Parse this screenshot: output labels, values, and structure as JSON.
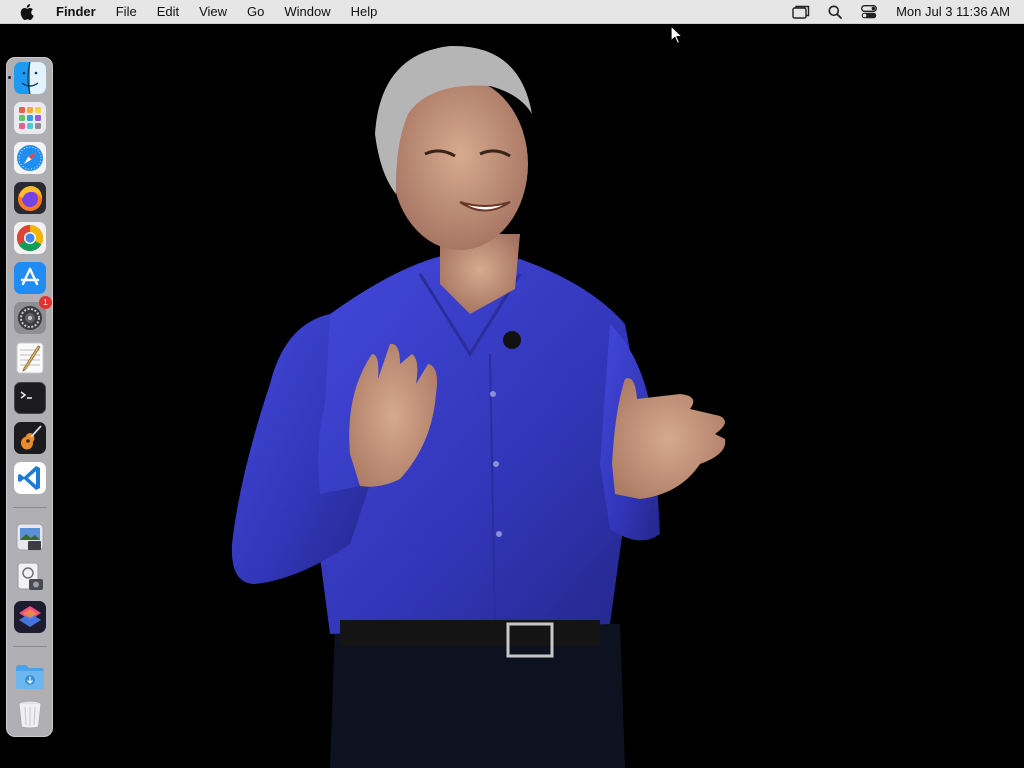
{
  "menubar": {
    "app_name": "Finder",
    "menus": [
      "File",
      "Edit",
      "View",
      "Go",
      "Window",
      "Help"
    ],
    "clock": "Mon Jul 3  11:36 AM"
  },
  "dock": {
    "items": [
      {
        "name": "Finder",
        "icon": "finder-icon",
        "running": true
      },
      {
        "name": "Launchpad",
        "icon": "launchpad-icon"
      },
      {
        "name": "Safari",
        "icon": "safari-icon"
      },
      {
        "name": "Firefox",
        "icon": "firefox-icon"
      },
      {
        "name": "Google Chrome",
        "icon": "chrome-icon"
      },
      {
        "name": "App Store",
        "icon": "app-store-icon"
      },
      {
        "name": "System Settings",
        "icon": "system-settings-icon",
        "badge": "1"
      },
      {
        "name": "TextEdit",
        "icon": "textedit-icon"
      },
      {
        "name": "Terminal",
        "icon": "terminal-icon"
      },
      {
        "name": "GarageBand",
        "icon": "garageband-icon"
      },
      {
        "name": "Visual Studio Code",
        "icon": "vscode-icon"
      },
      {
        "name": "Preview",
        "icon": "preview-icon"
      },
      {
        "name": "Image Capture",
        "icon": "image-capture-icon"
      },
      {
        "name": "Shortcuts",
        "icon": "shortcuts-icon"
      },
      {
        "name": "Downloads",
        "icon": "downloads-folder-icon"
      },
      {
        "name": "Trash",
        "icon": "trash-icon"
      }
    ]
  },
  "wallpaper": {
    "description_icon": "presenter-wallpaper",
    "colors": {
      "shirt": "#3b3fd0",
      "background": "#000000",
      "hair": "#b8b8b8",
      "skin": "#c99a80"
    }
  }
}
